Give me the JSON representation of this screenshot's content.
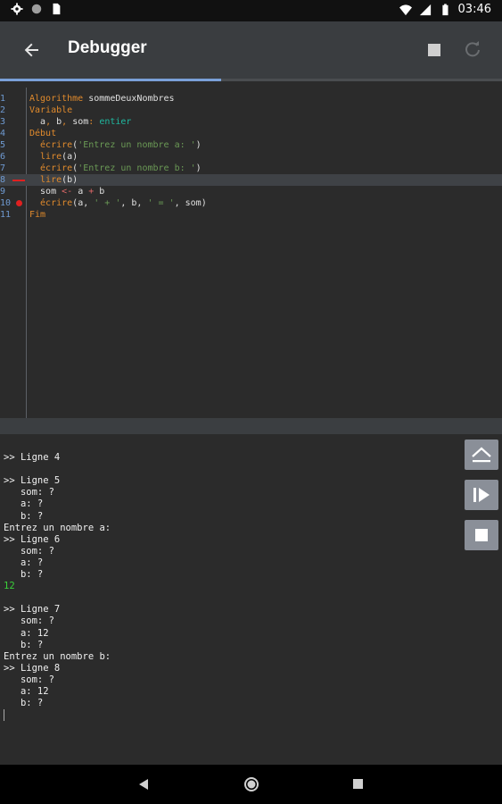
{
  "status_bar": {
    "time": "03:46"
  },
  "app_bar": {
    "title": "Debugger",
    "progress": 0.44
  },
  "editor": {
    "current_line": 8,
    "breakpoint_line": 10,
    "lines": [
      {
        "num": "1",
        "tokens": [
          {
            "t": "Algorithme",
            "c": "kw"
          },
          {
            "t": " sommeDeuxNombres",
            "c": ""
          }
        ]
      },
      {
        "num": "2",
        "tokens": [
          {
            "t": "Variable",
            "c": "kw"
          }
        ]
      },
      {
        "num": "3",
        "tokens": [
          {
            "t": "  a",
            "c": ""
          },
          {
            "t": ",",
            "c": "kw"
          },
          {
            "t": " b",
            "c": ""
          },
          {
            "t": ",",
            "c": "kw"
          },
          {
            "t": " som",
            "c": ""
          },
          {
            "t": ":",
            "c": "kw"
          },
          {
            "t": " entier",
            "c": "ty"
          }
        ]
      },
      {
        "num": "4",
        "tokens": [
          {
            "t": "Début",
            "c": "kw"
          }
        ]
      },
      {
        "num": "5",
        "tokens": [
          {
            "t": "  écrire",
            "c": "kw"
          },
          {
            "t": "(",
            "c": ""
          },
          {
            "t": "'Entrez un nombre a: '",
            "c": "str"
          },
          {
            "t": ")",
            "c": ""
          }
        ]
      },
      {
        "num": "6",
        "tokens": [
          {
            "t": "  lire",
            "c": "kw"
          },
          {
            "t": "(a)",
            "c": ""
          }
        ]
      },
      {
        "num": "7",
        "tokens": [
          {
            "t": "  écrire",
            "c": "kw"
          },
          {
            "t": "(",
            "c": ""
          },
          {
            "t": "'Entrez un nombre b: '",
            "c": "str"
          },
          {
            "t": ")",
            "c": ""
          }
        ]
      },
      {
        "num": "8",
        "tokens": [
          {
            "t": "  lire",
            "c": "kw"
          },
          {
            "t": "(b)",
            "c": ""
          }
        ]
      },
      {
        "num": "9",
        "tokens": [
          {
            "t": "  som ",
            "c": ""
          },
          {
            "t": "<-",
            "c": "op"
          },
          {
            "t": " a ",
            "c": ""
          },
          {
            "t": "+",
            "c": "op"
          },
          {
            "t": " b",
            "c": ""
          }
        ]
      },
      {
        "num": "10",
        "tokens": [
          {
            "t": "  écrire",
            "c": "kw"
          },
          {
            "t": "(a, ",
            "c": ""
          },
          {
            "t": "' + '",
            "c": "str"
          },
          {
            "t": ", b, ",
            "c": ""
          },
          {
            "t": "' = '",
            "c": "str"
          },
          {
            "t": ", som)",
            "c": ""
          }
        ]
      },
      {
        "num": "11",
        "tokens": [
          {
            "t": "Fim",
            "c": "kw"
          }
        ]
      }
    ]
  },
  "console": {
    "lines": [
      {
        "text": ">> Ligne 4",
        "type": "out"
      },
      {
        "text": "",
        "type": "out"
      },
      {
        "text": ">> Ligne 5",
        "type": "out"
      },
      {
        "text": "   som: ?",
        "type": "out"
      },
      {
        "text": "   a: ?",
        "type": "out"
      },
      {
        "text": "   b: ?",
        "type": "out"
      },
      {
        "text": "Entrez un nombre a:",
        "type": "out"
      },
      {
        "text": ">> Ligne 6",
        "type": "out"
      },
      {
        "text": "   som: ?",
        "type": "out"
      },
      {
        "text": "   a: ?",
        "type": "out"
      },
      {
        "text": "   b: ?",
        "type": "out"
      },
      {
        "text": "12",
        "type": "input"
      },
      {
        "text": "",
        "type": "out"
      },
      {
        "text": ">> Ligne 7",
        "type": "out"
      },
      {
        "text": "   som: ?",
        "type": "out"
      },
      {
        "text": "   a: 12",
        "type": "out"
      },
      {
        "text": "   b: ?",
        "type": "out"
      },
      {
        "text": "Entrez un nombre b:",
        "type": "out"
      },
      {
        "text": ">> Ligne 8",
        "type": "out"
      },
      {
        "text": "   som: ?",
        "type": "out"
      },
      {
        "text": "   a: 12",
        "type": "out"
      },
      {
        "text": "   b: ?",
        "type": "out"
      }
    ]
  },
  "side_buttons": [
    {
      "name": "step-over-button",
      "icon": "step-icon"
    },
    {
      "name": "continue-button",
      "icon": "play-icon"
    },
    {
      "name": "console-stop-button",
      "icon": "stop-icon"
    }
  ],
  "icons": {
    "status_left": [
      "gear-icon",
      "circle-icon",
      "sim-card-icon"
    ],
    "status_right": [
      "wifi-icon",
      "signal-icon",
      "battery-icon"
    ],
    "nav": [
      "back-triangle-icon",
      "home-circle-icon",
      "recents-square-icon"
    ]
  },
  "colors": {
    "keyword": "#e08a2c",
    "type": "#1fb9a0",
    "string": "#6a9955",
    "operator": "#e06868",
    "line_number": "#6f9ad1",
    "input": "#3ad13a",
    "breakpoint": "#e02020"
  }
}
